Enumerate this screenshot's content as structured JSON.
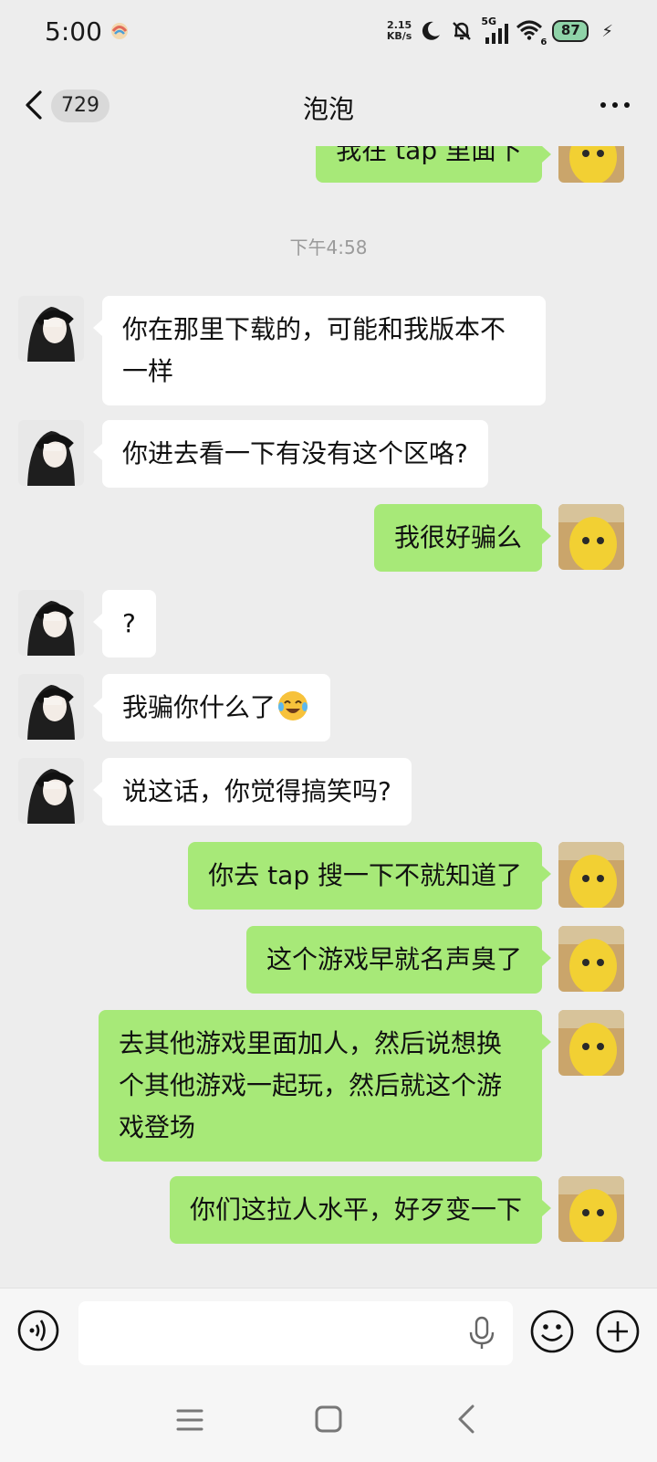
{
  "status_bar": {
    "time": "5:00",
    "net_speed_value": "2.15",
    "net_speed_unit": "KB/s",
    "network_type": "5G",
    "wifi_sub": "6",
    "battery": "87",
    "icons": [
      "app-notification-icon",
      "moon-icon",
      "mute-bell-icon",
      "signal-icon",
      "wifi-icon",
      "battery-icon",
      "charging-icon"
    ]
  },
  "header": {
    "unread_count": "729",
    "title": "泡泡"
  },
  "messages": [
    {
      "dir": "out",
      "text": "我在 tap 里面下"
    },
    {
      "dir": "time",
      "text": "下午4:58"
    },
    {
      "dir": "in",
      "text": "你在那里下载的，可能和我版本不一样"
    },
    {
      "dir": "in",
      "text": "你进去看一下有没有这个区咯?"
    },
    {
      "dir": "out",
      "text": "我很好骗么"
    },
    {
      "dir": "in",
      "text": "?"
    },
    {
      "dir": "in",
      "text": "我骗你什么了",
      "emoji": "laughing-crying-emoji"
    },
    {
      "dir": "in",
      "text": "说这话，你觉得搞笑吗?"
    },
    {
      "dir": "out",
      "text": "你去 tap 搜一下不就知道了"
    },
    {
      "dir": "out",
      "text": "这个游戏早就名声臭了"
    },
    {
      "dir": "out",
      "text": "去其他游戏里面加人，然后说想换个其他游戏一起玩，然后就这个游戏登场"
    },
    {
      "dir": "out",
      "text": "你们这拉人水平，好歹变一下"
    }
  ],
  "input_bar": {
    "placeholder": ""
  },
  "colors": {
    "background": "#ededed",
    "outgoing_bubble": "#a7e978",
    "incoming_bubble": "#ffffff"
  }
}
